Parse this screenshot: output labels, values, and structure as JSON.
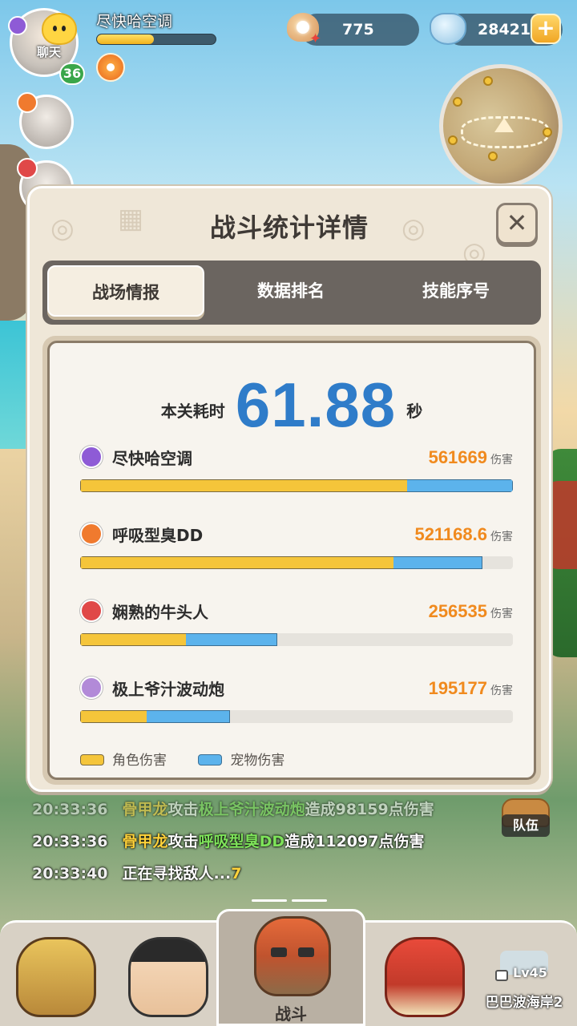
{
  "hud": {
    "chat_label": "聊天",
    "level": "36",
    "player_name": "尽快哈空调",
    "exp_progress": 0.48,
    "pearls": "775",
    "diamonds": "28421"
  },
  "panel": {
    "title": "战斗统计详情",
    "close_icon": "close-icon",
    "tabs": [
      {
        "label": "战场情报",
        "active": true
      },
      {
        "label": "数据排名",
        "active": false
      },
      {
        "label": "技能序号",
        "active": false
      }
    ],
    "time_label": "本关耗时",
    "time_value": "61.88",
    "time_unit": "秒",
    "damage_unit": "伤害",
    "stats": [
      {
        "name": "尽快哈空调",
        "damage": "561669",
        "role_ratio": 0.755,
        "pet_ratio": 0.245,
        "total_ratio": 1.0,
        "icon_color": "#8e5bd6"
      },
      {
        "name": "呼吸型臭DD",
        "damage": "521168.6",
        "role_ratio": 0.724,
        "pet_ratio": 0.206,
        "total_ratio": 0.93,
        "icon_color": "#f07a2e"
      },
      {
        "name": "娴熟的牛头人",
        "damage": "256535",
        "role_ratio": 0.245,
        "pet_ratio": 0.21,
        "total_ratio": 0.455,
        "icon_color": "#e04848"
      },
      {
        "name": "极上爷汁波动炮",
        "damage": "195177",
        "role_ratio": 0.153,
        "pet_ratio": 0.194,
        "total_ratio": 0.347,
        "icon_color": "#b28ad8"
      }
    ],
    "legend": {
      "role_label": "角色伤害",
      "pet_label": "宠物伤害",
      "role_color": "#f5c53a",
      "pet_color": "#5cb3ec"
    }
  },
  "log": {
    "rows": [
      {
        "time": "20:33:36",
        "attacker": "骨甲龙",
        "verb": "攻击",
        "target": "极上爷汁波动炮",
        "mid": "造成",
        "amount": "98159",
        "suffix": "点伤害"
      },
      {
        "time": "20:33:36",
        "attacker": "骨甲龙",
        "verb": "攻击",
        "target": "呼吸型臭DD",
        "mid": "造成",
        "amount": "112097",
        "suffix": "点伤害"
      },
      {
        "time": "20:33:40",
        "text": "正在寻找敌人...",
        "count": "7"
      }
    ]
  },
  "team_label": "队伍",
  "bottom_nav": {
    "battle_label": "战斗",
    "stage_level": "Lv45",
    "stage_name": "巴巴波海岸2"
  }
}
